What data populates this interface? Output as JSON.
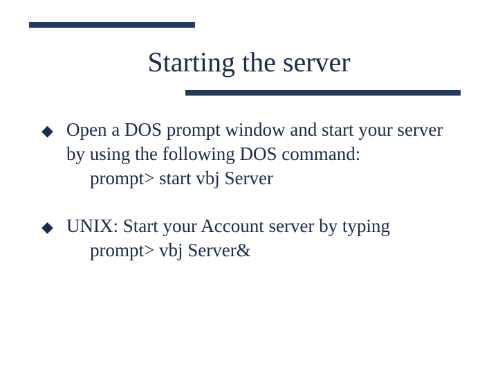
{
  "title": "Starting the server",
  "bullets": [
    {
      "text": "Open a DOS prompt window and start your server by using the following DOS command:",
      "command": "prompt> start vbj Server"
    },
    {
      "text": "UNIX: Start your Account server by typing",
      "command": "prompt> vbj Server&"
    }
  ]
}
